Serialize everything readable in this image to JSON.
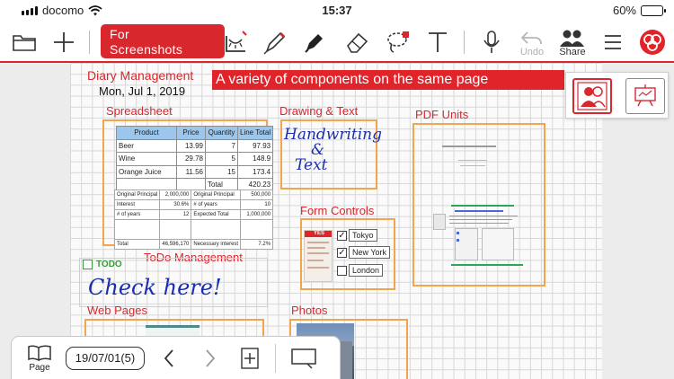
{
  "status_bar": {
    "carrier": "docomo",
    "time": "15:37",
    "battery": "60%",
    "battery_level": 0.6
  },
  "toolbar": {
    "screenshots_button": "For\nScreenshots",
    "undo_label": "Undo",
    "share_label": "Share"
  },
  "note": {
    "banner": "A variety of components on the same page",
    "diary_title": "Diary Management",
    "date": "Mon, Jul 1, 2019",
    "spreadsheet_title": "Spreadsheet",
    "drawing_title": "Drawing & Text",
    "pdf_title": "PDF Units",
    "form_title": "Form Controls",
    "todo_title": "ToDo Management",
    "todo_badge": "TODO",
    "web_title": "Web Pages",
    "photos_title": "Photos",
    "handwriting": "Handwriting",
    "handwriting_amp": "&",
    "handwriting_text": "Text",
    "check_here": "Check here!"
  },
  "spreadsheet": {
    "headers": [
      "Product",
      "Price",
      "Quantity",
      "Line Total"
    ],
    "rows": [
      [
        "Beer",
        "13.99",
        "7",
        "97.93"
      ],
      [
        "Wine",
        "29.78",
        "5",
        "148.9"
      ],
      [
        "Orange Juice",
        "11.56",
        "15",
        "173.4"
      ]
    ],
    "total_label": "Total",
    "total_value": "420.23",
    "loan_rows": [
      [
        "Original Principal",
        "2,000,000",
        "Original Principal",
        "500,000"
      ],
      [
        "Interest",
        "30.6%",
        "# of years",
        "10"
      ],
      [
        "# of years",
        "12",
        "Expected Total",
        "1,000,000"
      ],
      [
        "Total",
        "46,596,170",
        "Necessary interest",
        "7.2%"
      ]
    ]
  },
  "form_controls": {
    "yes_label": "YES",
    "options": [
      {
        "label": "Tokyo",
        "checked": true
      },
      {
        "label": "New York",
        "checked": true
      },
      {
        "label": "London",
        "checked": false
      }
    ],
    "check_mark": "✓"
  },
  "bottom_bar": {
    "page_label": "Page",
    "date": "19/07/01(5)"
  },
  "colors": {
    "accent_red": "#d8282e",
    "frame_orange": "#f2a54d",
    "ink_blue": "#1a2fb0",
    "todo_green": "#3a9a3a"
  },
  "icons": {
    "toolbar": [
      "folder-icon",
      "plus-icon",
      "scan-icon",
      "pen-icon",
      "marker-icon",
      "eraser-icon",
      "lasso-icon",
      "text-icon",
      "microphone-icon",
      "undo-icon",
      "share-icon",
      "menu-icon",
      "app-logo-icon"
    ],
    "bottom": [
      "page-icon",
      "chevron-left-icon",
      "chevron-right-icon",
      "add-page-icon",
      "zoom-window-icon"
    ],
    "float_panel": [
      "profile-icon",
      "presentation-icon"
    ]
  }
}
